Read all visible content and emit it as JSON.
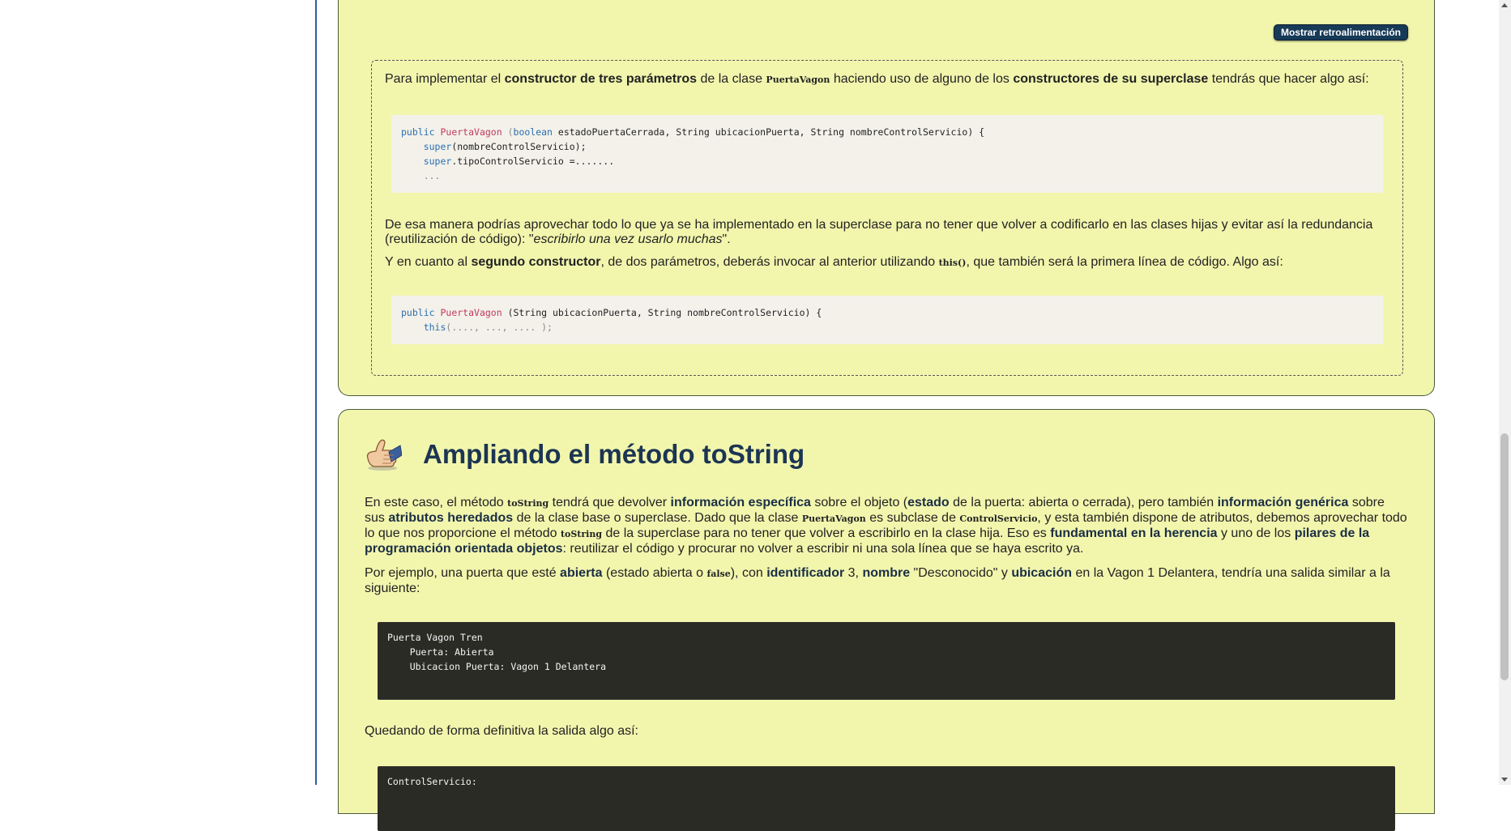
{
  "feedback": {
    "button_label": "Mostrar retroalimentación",
    "p1": {
      "t1": "Para implementar el ",
      "b1": "constructor de tres parámetros",
      "t2": " de la clase ",
      "code1": "PuertaVagon",
      "t3": " haciendo uso de alguno de los ",
      "b2": "constructores de su superclase",
      "t4": " tendrás que hacer algo así:"
    },
    "code_block_1": {
      "line1_kw": "public",
      "line1_cls": "PuertaVagon",
      "line1_rest_a": " (",
      "line1_kw2": "boolean",
      "line1_rest_b": " estadoPuertaCerrada, String ubicacionPuerta, String nombreControlServicio) {",
      "line2_kw": "super",
      "line2_rest": "(nombreControlServicio);",
      "line3_kw": "super",
      "line3_rest": ".tipoControlServicio =.......",
      "line4": "..."
    },
    "p2": {
      "t1": "De esa manera podrías aprovechar todo lo que ya se ha implementado en la superclase para no tener que volver a codificarlo en las clases hijas y evitar así la redundancia (reutilización de código): \"",
      "i1": "escribirlo una vez usarlo muchas",
      "t2": "\"."
    },
    "p3": {
      "t1": "Y en cuanto al ",
      "b1": "segundo constructor",
      "t2": ", de dos parámetros, deberás invocar al anterior utilizando ",
      "code1": "this()",
      "t3": ", que también será la primera línea de código. Algo así:"
    },
    "code_block_2": {
      "line1_kw": "public",
      "line1_cls": "PuertaVagon",
      "line1_rest": " (String ubicacionPuerta, String nombreControlServicio) {",
      "line2_kw": "this",
      "line2_rest": "(...., ..., .... );"
    }
  },
  "section": {
    "title": "Ampliando el método toString",
    "icon": "thumbs-up-hand-icon",
    "para1": {
      "t1": "En este caso, el método ",
      "c1": "toString",
      "t2": " tendrá que devolver ",
      "b1": "información específica",
      "t3": " sobre el objeto (",
      "b2": "estado",
      "t4": " de la puerta: abierta o cerrada), pero también ",
      "b3": "información genérica",
      "t5": " sobre sus ",
      "b4": "atributos heredados",
      "t6": " de la clase base o superclase. Dado que la clase ",
      "c2": "PuertaVagon",
      "t7": " es subclase de ",
      "c3": "ControlServicio",
      "t8": ", y esta también dispone de atributos, debemos aprovechar todo lo que nos proporcione el método ",
      "c4": "toString",
      "t9": " de la superclase para no tener que volver a escribirlo en la clase hija. Eso es ",
      "b5": "fundamental en la herencia",
      "t10": " y uno de los ",
      "b6": "pilares de la programación orientada objetos",
      "t11": ": reutilizar el código y procurar no volver a escribir ni una sola línea que se haya escrito ya."
    },
    "para2": {
      "t1": "Por ejemplo, una puerta que esté ",
      "b1": "abierta",
      "t2": " (estado abierta o ",
      "c1": "false",
      "t3": "), con ",
      "b2": "identificador",
      "t4": " 3, ",
      "b3": "nombre",
      "t5": " \"Desconocido\" y ",
      "b4": "ubicación",
      "t6": " en la Vagon 1 Delantera, tendría una salida similar a la siguiente:"
    },
    "output1": "Puerta Vagon Tren\n    Puerta: Abierta\n    Ubicacion Puerta: Vagon 1 Delantera",
    "para3": "Quedando de forma definitiva la salida algo así:",
    "output2": "ControlServicio:"
  }
}
